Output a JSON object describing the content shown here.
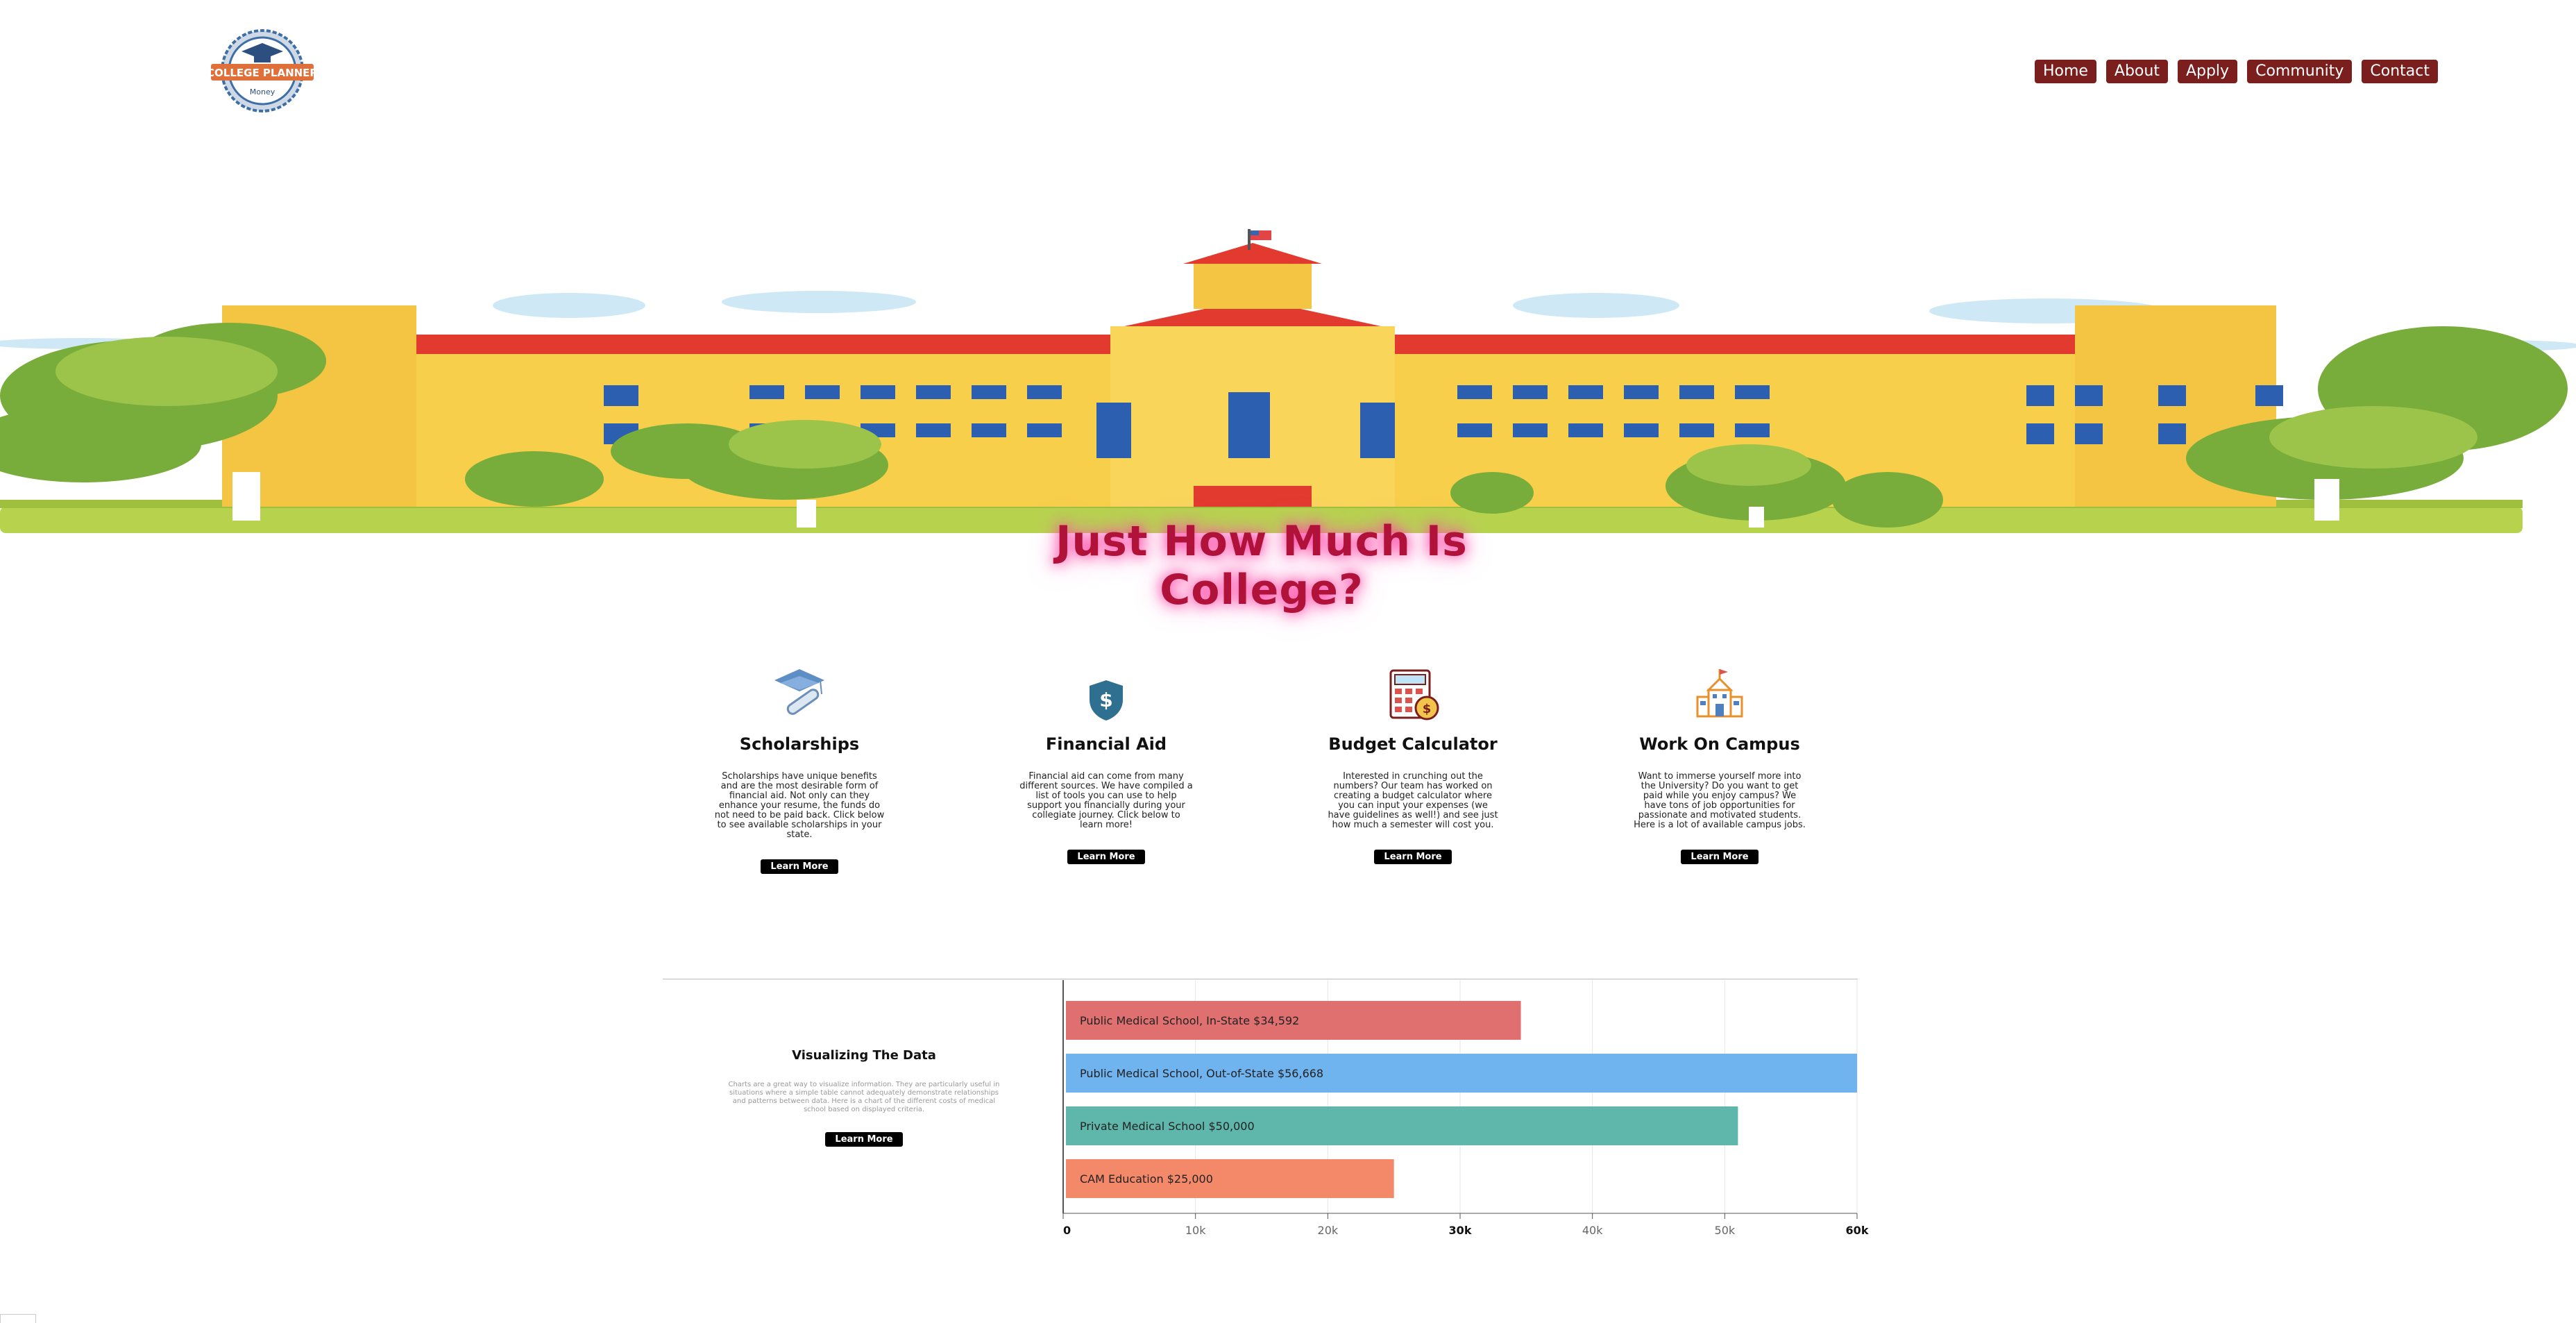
{
  "header": {
    "logo_text": "COLLEGE PLANNER",
    "logo_subtext": "Money",
    "nav": [
      "Home",
      "About",
      "Apply",
      "Community",
      "Contact"
    ]
  },
  "hero": {
    "title": "Just How Much Is College?"
  },
  "features": [
    {
      "icon": "graduation-cap-diploma-icon",
      "title": "Scholarships",
      "text": "Scholarships have unique benefits and are the most desirable form of financial aid. Not only can they enhance your resume, the funds do not need to be paid back. Click below to see available scholarships in your state.",
      "button": "Learn More"
    },
    {
      "icon": "dollar-shield-icon",
      "title": "Financial Aid",
      "text": "Financial aid can come from many different sources. We have compiled a list of tools you can use to help support you financially during your collegiate journey. Click below to learn more!",
      "button": "Learn More"
    },
    {
      "icon": "calculator-coin-icon",
      "title": "Budget Calculator",
      "text": "Interested in crunching out the numbers? Our team has worked on creating a budget calculator where you can input your expenses (we have guidelines as well!) and see just how much a semester will cost you.",
      "button": "Learn More"
    },
    {
      "icon": "campus-building-icon",
      "title": "Work On Campus",
      "text": "Want to immerse yourself more into the University? Do you want to get paid while you enjoy campus? We have tons of job opportunities for passionate and motivated students. Here is a lot of available campus jobs.",
      "button": "Learn More"
    }
  ],
  "viz": {
    "title": "Visualizing The Data",
    "text": "Charts are a great way to visualize information. They are particularly useful in situations where a simple table cannot adequately demonstrate relationships and patterns between data. Here is a chart of the different costs of medical school based on displayed criteria.",
    "button": "Learn More"
  },
  "chart_data": {
    "type": "bar",
    "orientation": "horizontal",
    "categories": [
      "Public Medical School, In-State $34,592",
      "Public Medical School, Out-of-State $56,668",
      "Private Medical School $50,000",
      "CAM Education $25,000"
    ],
    "values": [
      34592,
      60000,
      51000,
      25000
    ],
    "colors": [
      "#e07070",
      "#6fb3ef",
      "#5fb6ab",
      "#f4896a"
    ],
    "xlim": [
      0,
      60000
    ],
    "xticks": [
      "0",
      "10k",
      "20k",
      "30k",
      "40k",
      "50k",
      "60k"
    ],
    "bold_ticks": [
      "0",
      "30k",
      "60k"
    ],
    "grid": true
  }
}
